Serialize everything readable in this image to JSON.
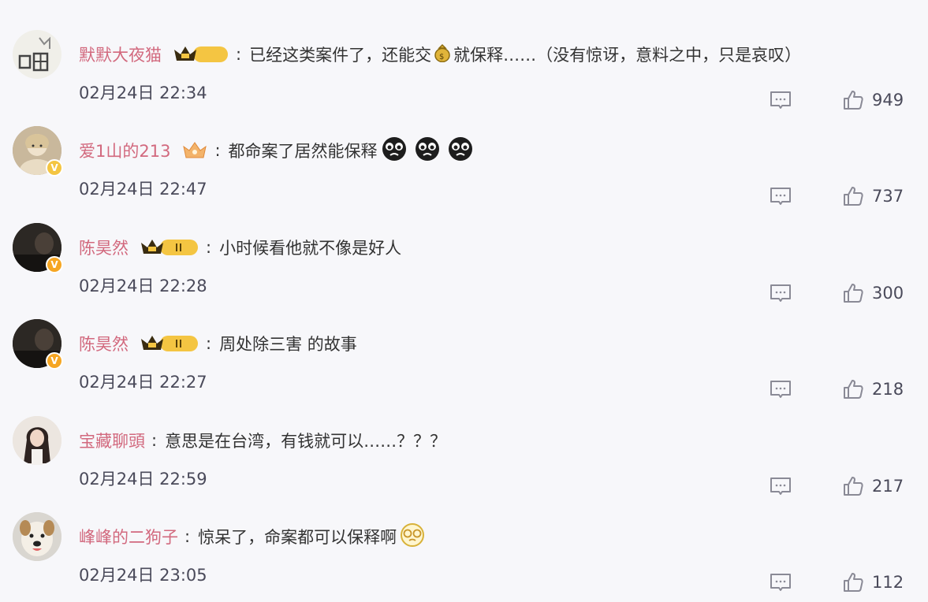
{
  "comments": [
    {
      "username": "默默大夜猫",
      "badge_level": "I",
      "text_before": "已经这类案件了，还能交",
      "text_after": "就保释……（没有惊讶，意料之中，只是哀叹）",
      "time": "02月24日 22:34",
      "likes": "949"
    },
    {
      "username": "爱1山的213",
      "text": "都命案了居然能保释",
      "time": "02月24日 22:47",
      "likes": "737"
    },
    {
      "username": "陈昊然",
      "badge_level": "II",
      "text": "小时候看他就不像是好人",
      "time": "02月24日 22:28",
      "likes": "300"
    },
    {
      "username": "陈昊然",
      "badge_level": "II",
      "text": "周处除三害 的故事",
      "time": "02月24日 22:27",
      "likes": "218"
    },
    {
      "username": "宝藏聊頭",
      "text": "意思是在台湾，有钱就可以……？？？",
      "time": "02月24日 22:59",
      "likes": "217"
    },
    {
      "username": "峰峰的二狗子",
      "text": "惊呆了，命案都可以保释啊",
      "time": "02月24日 23:05",
      "likes": "112"
    }
  ],
  "colors": {
    "username": "#d2697e",
    "badge_gold": "#f4c542",
    "verified": "#f6a623",
    "icon_gray": "#8a8a96"
  }
}
